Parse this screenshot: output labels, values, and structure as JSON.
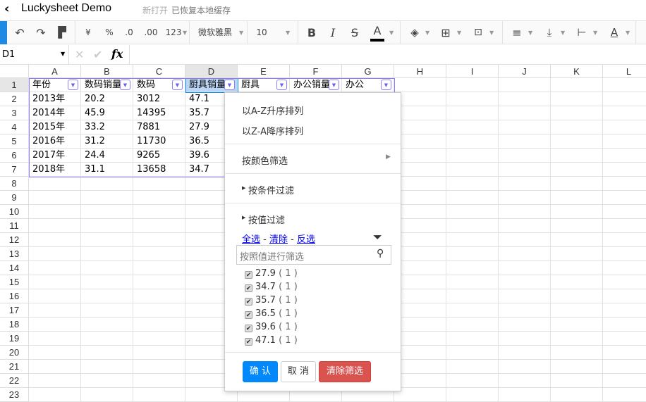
{
  "app": {
    "title": "Luckysheet Demo",
    "status_new": "新打开",
    "status_restored": "已恢复本地缓存"
  },
  "toolbar": {
    "currency": "¥",
    "percent": "%",
    "decrease_decimal": ".0",
    "increase_decimal": ".00",
    "number_format": "123",
    "font": "微软雅黑",
    "font_size": "10",
    "bold": "B",
    "italic": "I",
    "strike": "S",
    "text_color": "A",
    "text_color_value": "#000000",
    "accent": "#1e88e5"
  },
  "formula_bar": {
    "cell_ref": "D1",
    "fx": "fx"
  },
  "columns": [
    "A",
    "B",
    "C",
    "D",
    "E",
    "F",
    "G",
    "H",
    "I",
    "J",
    "K",
    "L"
  ],
  "rows": [
    "1",
    "2",
    "3",
    "4",
    "5",
    "6",
    "7",
    "8",
    "9",
    "10",
    "11",
    "12",
    "13",
    "14",
    "15",
    "16",
    "17",
    "18",
    "19",
    "20",
    "21",
    "22",
    "23"
  ],
  "cells": [
    [
      "年份",
      "数码销量",
      "数码",
      "厨具销量",
      "厨具",
      "办公销量",
      "办公"
    ],
    [
      "2013年",
      "20.2",
      "3012",
      "47.1"
    ],
    [
      "2014年",
      "45.9",
      "14395",
      "35.7"
    ],
    [
      "2015年",
      "33.2",
      "7881",
      "27.9"
    ],
    [
      "2016年",
      "31.2",
      "11730",
      "36.5"
    ],
    [
      "2017年",
      "24.4",
      "9265",
      "39.6"
    ],
    [
      "2018年",
      "31.1",
      "13658",
      "34.7"
    ]
  ],
  "filter_menu": {
    "sort_asc": "以A-Z升序排列",
    "sort_desc": "以Z-A降序排列",
    "filter_by_color": "按颜色筛选",
    "filter_by_condition": "按条件过滤",
    "filter_by_value": "按值过滤",
    "select_all": "全选",
    "clear": "清除",
    "invert": "反选",
    "search_placeholder": "按照值进行筛选",
    "values": [
      {
        "label": "27.9",
        "count": "( 1 )",
        "checked": true
      },
      {
        "label": "34.7",
        "count": "( 1 )",
        "checked": true
      },
      {
        "label": "35.7",
        "count": "( 1 )",
        "checked": true
      },
      {
        "label": "36.5",
        "count": "( 1 )",
        "checked": true
      },
      {
        "label": "39.6",
        "count": "( 1 )",
        "checked": true
      },
      {
        "label": "47.1",
        "count": "( 1 )",
        "checked": true
      }
    ],
    "confirm": "确 认",
    "cancel": "取 消",
    "clear_filter": "清除筛选"
  }
}
